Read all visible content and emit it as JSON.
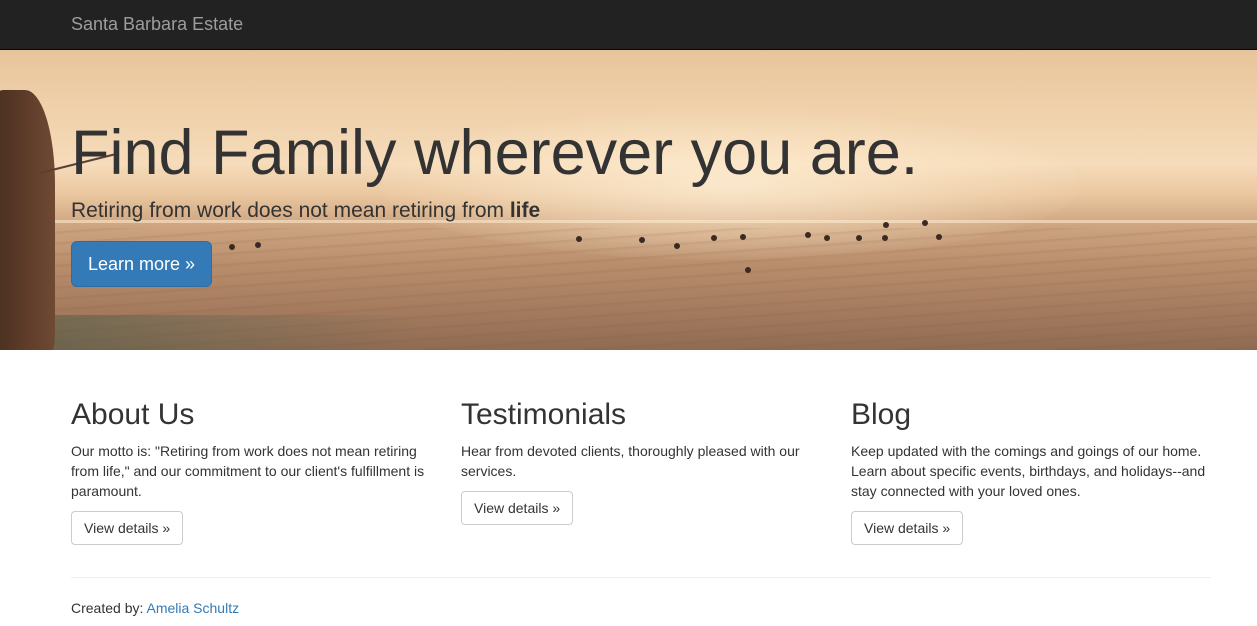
{
  "navbar": {
    "brand": "Santa Barbara Estate"
  },
  "hero": {
    "title": "Find Family wherever you are.",
    "subtitle_prefix": "Retiring from work does not mean retiring from",
    "subtitle_bold": "life",
    "cta_label": "Learn more »",
    "cta_color": "#337ab7"
  },
  "columns": [
    {
      "heading": "About Us",
      "text": "Our motto is: \"Retiring from work does not mean retiring from life,\" and our commitment to our client's fulfillment is paramount.",
      "button": "View details »"
    },
    {
      "heading": "Testimonials",
      "text": "Hear from devoted clients, thoroughly pleased with our services.",
      "button": "View details »"
    },
    {
      "heading": "Blog",
      "text": "Keep updated with the comings and goings of our home. Learn about specific events, birthdays, and holidays--and stay connected with your loved ones.",
      "button": "View details »"
    }
  ],
  "footer": {
    "created_by_label": "Created by:",
    "author": "Amelia Schultz",
    "link_color": "#337ab7"
  },
  "colors": {
    "navbar_bg": "#222222",
    "brand_text": "#9d9d9d",
    "body_text": "#333333"
  }
}
